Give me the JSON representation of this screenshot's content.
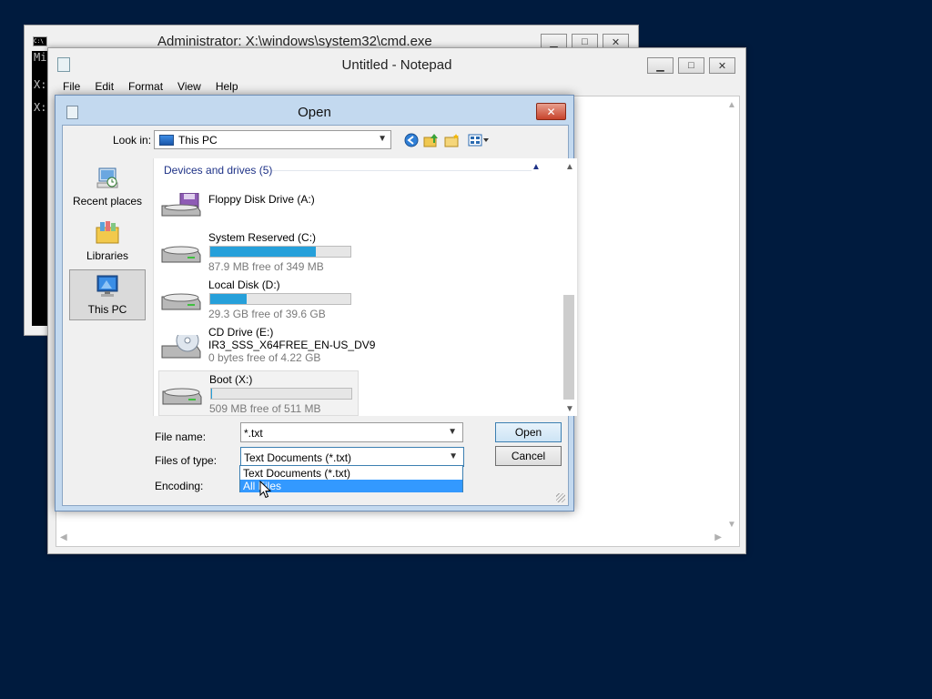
{
  "cmd": {
    "title": "Administrator: X:\\windows\\system32\\cmd.exe",
    "icon_text": "C:\\",
    "lines": [
      "Mi",
      "",
      "X:",
      "",
      "X:"
    ]
  },
  "notepad": {
    "title": "Untitled - Notepad",
    "menu": [
      "File",
      "Edit",
      "Format",
      "View",
      "Help"
    ]
  },
  "open_dialog": {
    "title": "Open",
    "look_in_label": "Look in:",
    "look_in_value": "This PC",
    "places": [
      {
        "label": "Recent places"
      },
      {
        "label": "Libraries"
      },
      {
        "label": "This PC"
      }
    ],
    "group_header": "Devices and drives (5)",
    "drives": [
      {
        "name": "Floppy Disk Drive (A:)",
        "sub": "",
        "label": "",
        "used_fraction": null
      },
      {
        "name": "System Reserved (C:)",
        "sub": "87.9 MB free of 349 MB",
        "label": "",
        "used_fraction": 0.75
      },
      {
        "name": "Local Disk (D:)",
        "sub": "29.3 GB free of 39.6 GB",
        "label": "",
        "used_fraction": 0.26
      },
      {
        "name": "CD Drive (E:)",
        "label": "IR3_SSS_X64FREE_EN-US_DV9",
        "sub": "0 bytes free of 4.22 GB",
        "used_fraction": null
      },
      {
        "name": "Boot (X:)",
        "sub": "509 MB free of 511 MB",
        "label": "",
        "used_fraction": 0.004
      }
    ],
    "file_name_label": "File name:",
    "file_name_value": "*.txt",
    "files_of_type_label": "Files of type:",
    "files_of_type_value": "Text Documents (*.txt)",
    "encoding_label": "Encoding:",
    "type_options": [
      "Text Documents (*.txt)",
      "All Files"
    ],
    "open_button": "Open",
    "cancel_button": "Cancel"
  },
  "colors": {
    "desktop": "#001b3e",
    "selection": "#3399ff",
    "drive_bar": "#26a0da",
    "group_header": "#1e3287"
  }
}
